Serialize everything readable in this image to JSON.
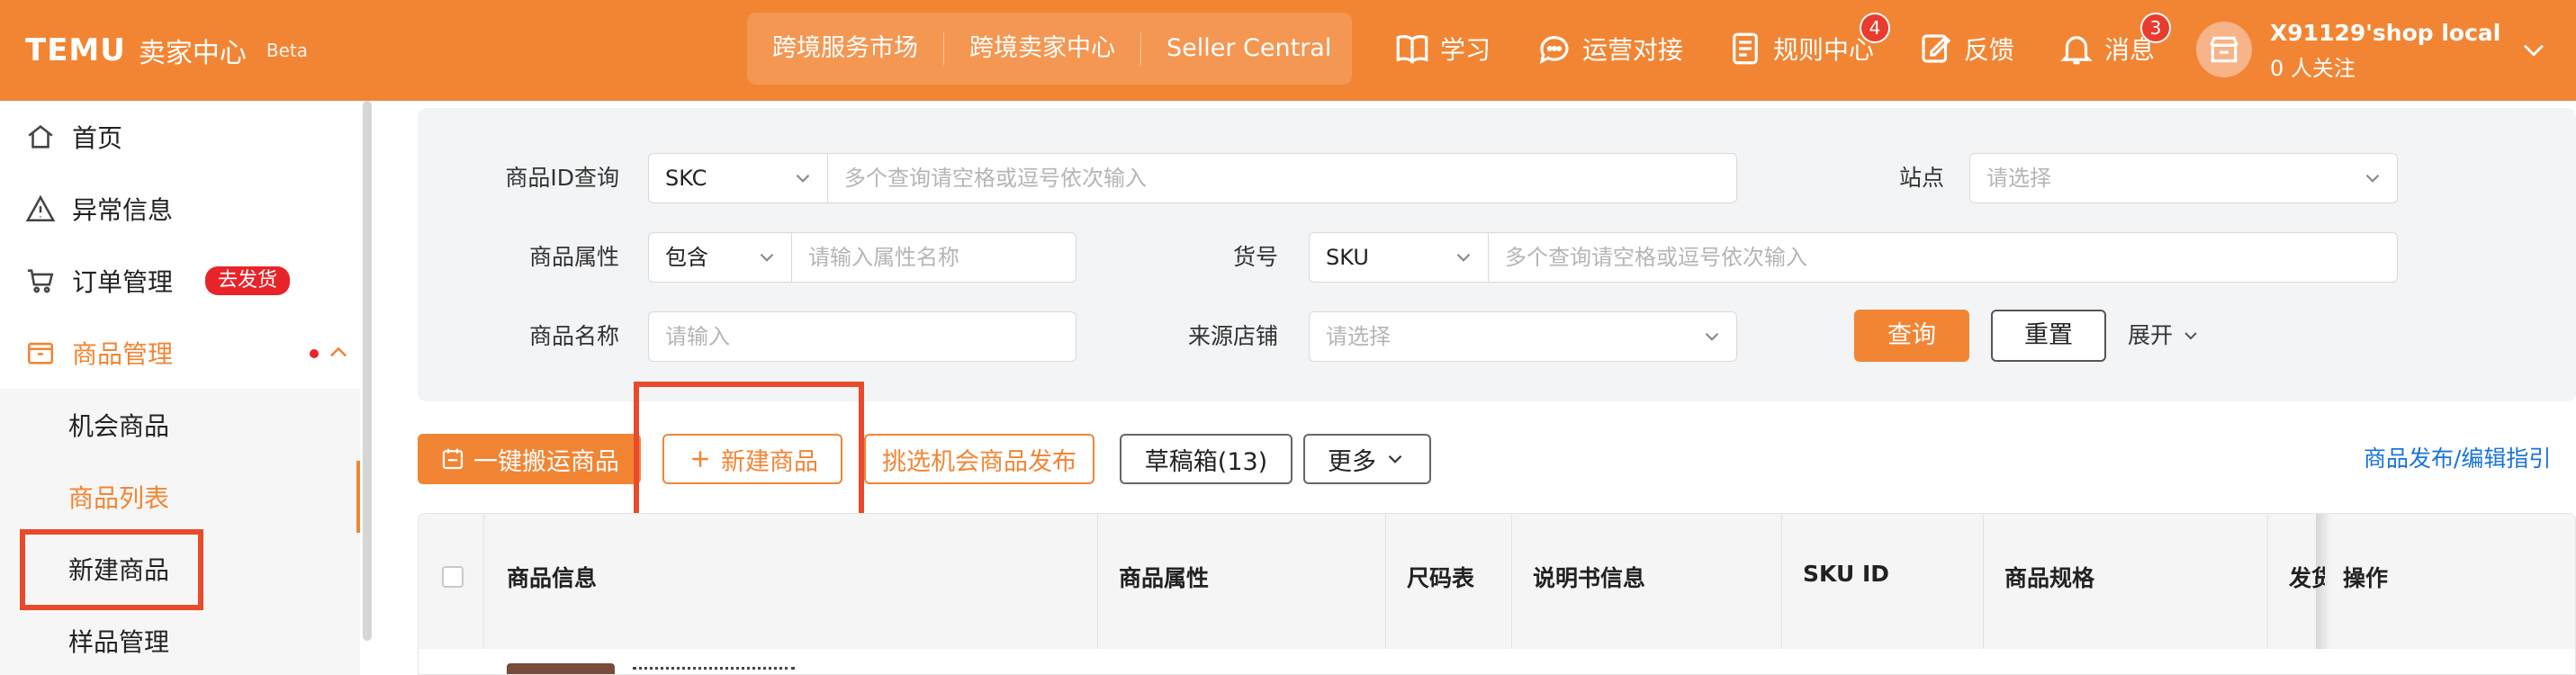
{
  "header": {
    "logo_main": "TEMU",
    "logo_sub": "卖家中心",
    "logo_beta": "Beta",
    "portal": [
      "跨境服务市场",
      "跨境卖家中心",
      "Seller Central"
    ],
    "nav": {
      "study": "学习",
      "ops": "运营对接",
      "rules": "规则中心",
      "rules_badge": "4",
      "feedback": "反馈",
      "messages": "消息",
      "messages_badge": "3"
    },
    "shop_name": "X91129'shop local",
    "shop_follow": "0 人关注"
  },
  "sidebar": {
    "items": [
      {
        "label": "首页",
        "icon": "home-icon"
      },
      {
        "label": "异常信息",
        "icon": "warning-icon"
      },
      {
        "label": "订单管理",
        "icon": "cart-icon",
        "tag": "去发货"
      },
      {
        "label": "商品管理",
        "icon": "product-box-icon"
      },
      {
        "label": "机会商品"
      },
      {
        "label": "商品列表"
      },
      {
        "label": "新建商品"
      },
      {
        "label": "样品管理"
      }
    ]
  },
  "filters": {
    "product_id_label": "商品ID查询",
    "product_id_type": "SKC",
    "product_id_placeholder": "多个查询请空格或逗号依次输入",
    "site_label": "站点",
    "site_placeholder": "请选择",
    "attr_label": "商品属性",
    "attr_mode": "包含",
    "attr_placeholder": "请输入属性名称",
    "sku_label": "货号",
    "sku_type": "SKU",
    "sku_placeholder": "多个查询请空格或逗号依次输入",
    "name_label": "商品名称",
    "name_placeholder": "请输入",
    "source_label": "来源店铺",
    "source_placeholder": "请选择",
    "query_button": "查询",
    "reset_button": "重置",
    "expand_link": "展开"
  },
  "actions": {
    "one_click_move": "一键搬运商品",
    "new_product": "新建商品",
    "pick_publish": "挑选机会商品发布",
    "drafts": "草稿箱(13)",
    "more": "更多",
    "guide_link": "商品发布/编辑指引"
  },
  "table": {
    "columns": [
      "商品信息",
      "商品属性",
      "尺码表",
      "说明书信息",
      "SKU ID",
      "商品规格",
      "发货",
      "操作"
    ]
  },
  "colors": {
    "brand": "#f28534",
    "highlight": "#ea4a2c",
    "badge_red": "#e8242a",
    "link_blue": "#1a73d9"
  }
}
